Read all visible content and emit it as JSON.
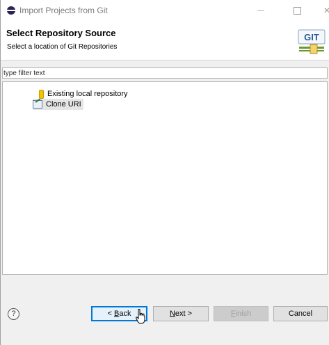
{
  "window": {
    "title": "Import Projects from Git",
    "minimize_icon": "minimize-icon",
    "maximize_icon": "maximize-icon",
    "close_glyph": "×"
  },
  "header": {
    "title": "Select Repository Source",
    "description": "Select a location of Git Repositories",
    "logo_text": "GIT"
  },
  "filter": {
    "placeholder": "type filter text",
    "value": ""
  },
  "tree": {
    "items": [
      {
        "label": "Existing local repository",
        "icon": "repository-icon",
        "selected": false
      },
      {
        "label": "Clone URI",
        "icon": "clone-uri-icon",
        "selected": true
      }
    ]
  },
  "footer": {
    "help_glyph": "?",
    "back": {
      "prefix": "< ",
      "mnemonic": "B",
      "rest": "ack"
    },
    "next": {
      "mnemonic": "N",
      "rest": "ext >"
    },
    "finish": {
      "mnemonic": "F",
      "rest": "inish",
      "enabled": false
    },
    "cancel": "Cancel"
  },
  "colors": {
    "accent": "#0078d7",
    "selection": "#e5e5e5",
    "git_green": "#6a9a2a"
  }
}
